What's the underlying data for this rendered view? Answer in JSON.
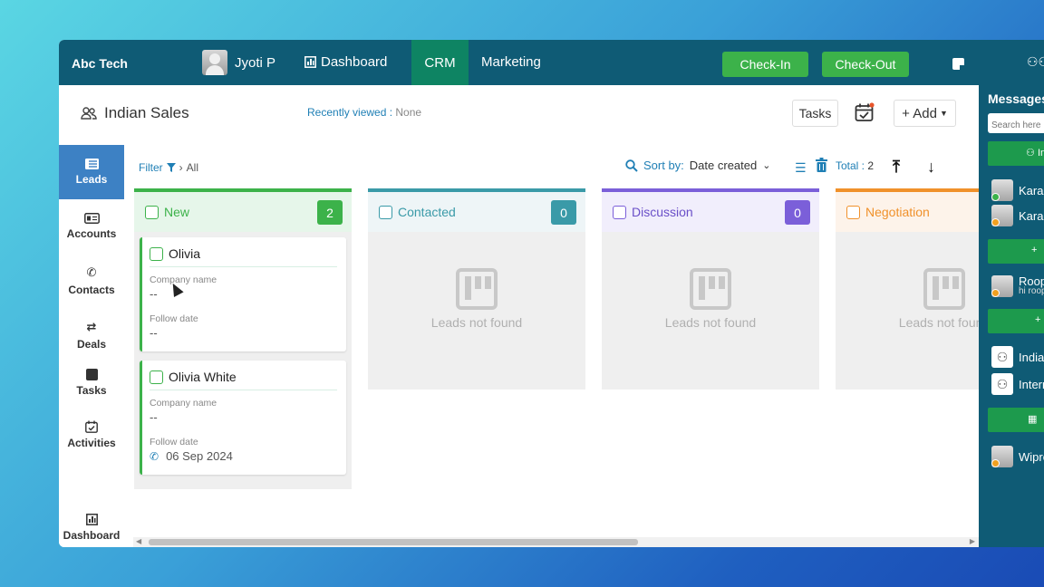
{
  "topbar": {
    "brand": "Abc Tech",
    "user_name": "Jyoti P",
    "nav": {
      "dashboard": "Dashboard",
      "crm": "CRM",
      "marketing": "Marketing"
    },
    "check_in": "Check-In",
    "check_out": "Check-Out"
  },
  "header": {
    "title": "Indian Sales",
    "recently_viewed_label": "Recently viewed :",
    "recently_viewed_value": "None",
    "tasks_label": "Tasks",
    "add_label": "+ Add"
  },
  "sidebar": {
    "items": [
      {
        "label": "Leads",
        "icon": "list-icon"
      },
      {
        "label": "Accounts",
        "icon": "id-card-icon"
      },
      {
        "label": "Contacts",
        "icon": "phone-icon"
      },
      {
        "label": "Deals",
        "icon": "exchange-icon"
      },
      {
        "label": "Tasks",
        "icon": "note-icon"
      },
      {
        "label": "Activities",
        "icon": "calendar-check-icon"
      },
      {
        "label": "Dashboard",
        "icon": "chart-icon"
      }
    ]
  },
  "toolbar": {
    "filter_label": "Filter",
    "filter_value": "All",
    "sort_label": "Sort by:",
    "sort_value": "Date created",
    "total_label": "Total :",
    "total_value": "2"
  },
  "columns": [
    {
      "name": "New",
      "count": "2",
      "color": "#3cb24a",
      "head_bg": "#e6f6ea"
    },
    {
      "name": "Contacted",
      "count": "0",
      "color": "#3a9aa8",
      "head_bg": "#eef5f7"
    },
    {
      "name": "Discussion",
      "count": "0",
      "color": "#7b5fd9",
      "head_bg": "#f1eefc"
    },
    {
      "name": "Negotiation",
      "count": "",
      "color": "#f0912b",
      "head_bg": "#fdf3ea"
    }
  ],
  "empty_text": "Leads not found",
  "leads": [
    {
      "name": "Olivia",
      "company_label": "Company name",
      "company": "--",
      "follow_label": "Follow date",
      "follow": "--"
    },
    {
      "name": "Olivia White",
      "company_label": "Company name",
      "company": "--",
      "follow_label": "Follow date",
      "follow": "06 Sep 2024"
    }
  ],
  "messages": {
    "title": "Messages",
    "search_placeholder": "Search here",
    "contacts": [
      {
        "name": "Karan",
        "status": "online"
      },
      {
        "name": "Karan",
        "status": "away"
      },
      {
        "name": "Roop",
        "sub": "hi roop",
        "status": "away"
      }
    ],
    "groups": [
      {
        "name": "India"
      },
      {
        "name": "International"
      }
    ],
    "company": "Wipro",
    "group_btn_label": "In"
  }
}
